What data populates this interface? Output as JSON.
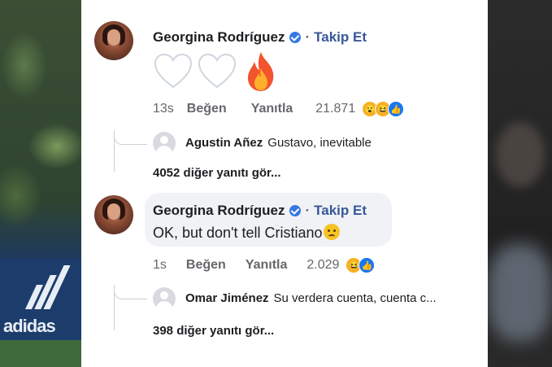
{
  "comments": [
    {
      "author": "Georgina Rodríguez",
      "separator": "·",
      "follow_label": "Takip Et",
      "timestamp": "13s",
      "like_label": "Beğen",
      "reply_label": "Yanıtla",
      "reaction_count": "21.871",
      "reactions": [
        "wow",
        "haha",
        "like"
      ],
      "content_emojis": [
        "white-heart",
        "white-heart",
        "fire"
      ],
      "reply_preview": {
        "author": "Agustin Añez",
        "text": "Gustavo, inevitable"
      },
      "more_replies": "4052 diğer yanıtı gör..."
    },
    {
      "author": "Georgina Rodríguez",
      "separator": "·",
      "follow_label": "Takip Et",
      "text": "OK, but don't tell Cristiano",
      "text_emoji": "pleading-face",
      "timestamp": "1s",
      "like_label": "Beğen",
      "reply_label": "Yanıtla",
      "reaction_count": "2.029",
      "reactions": [
        "haha",
        "like"
      ],
      "reply_preview": {
        "author": "Omar Jiménez",
        "text": "Su verdera cuenta, cuenta c..."
      },
      "more_replies": "398 diğer yanıtı gör..."
    }
  ],
  "background": {
    "left_brand": "adidas"
  },
  "colors": {
    "link": "#385898",
    "verified": "#3578e5",
    "muted": "#65676b",
    "bubble": "#f0f2f5"
  }
}
